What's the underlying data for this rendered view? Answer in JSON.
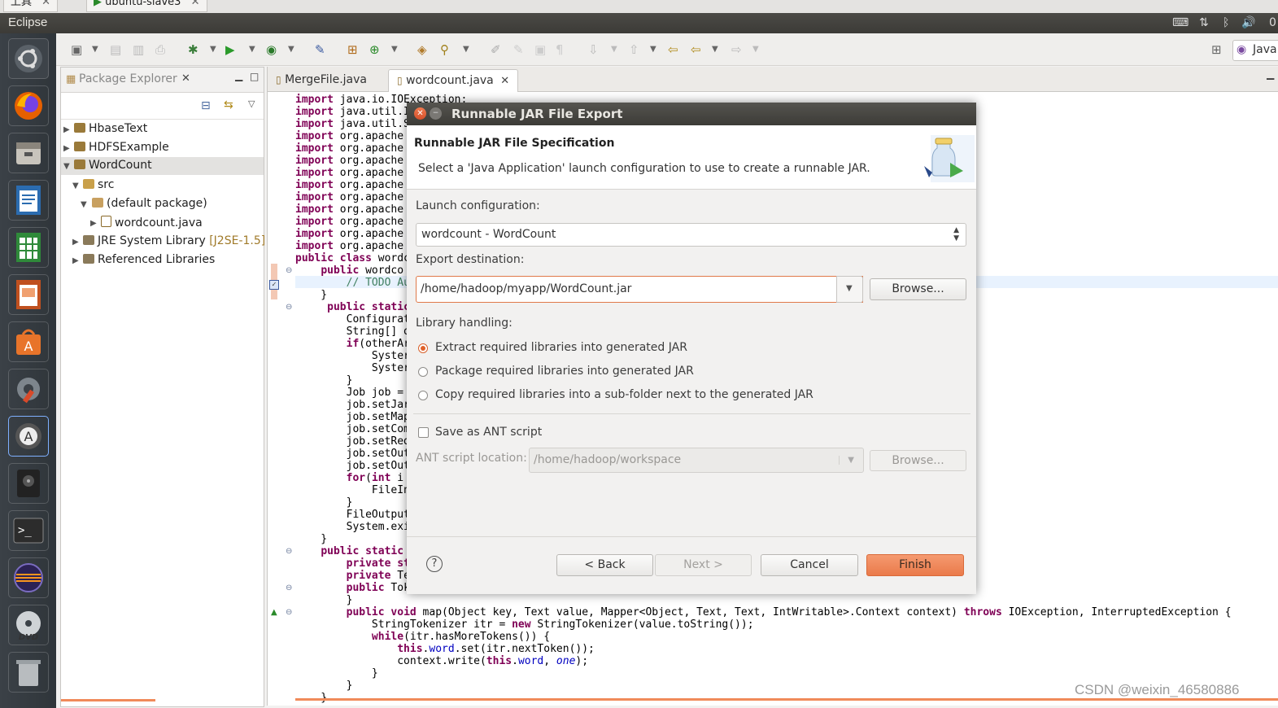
{
  "host_tabs": {
    "tab1": "上具",
    "tab2": "ubuntu-slave3"
  },
  "panel": {
    "app_title": "Eclipse",
    "clock_partial": "0"
  },
  "toolbar": {
    "perspective_label": "Java"
  },
  "package_explorer": {
    "title": "Package Explorer",
    "items": [
      {
        "label": "HbaseText"
      },
      {
        "label": "HDFSExample"
      },
      {
        "label": "WordCount"
      },
      {
        "label": "src"
      },
      {
        "label": "(default package)"
      },
      {
        "label": "wordcount.java"
      },
      {
        "label": "JRE System Library",
        "suffix": "[J2SE-1.5]"
      },
      {
        "label": "Referenced Libraries"
      }
    ]
  },
  "editor": {
    "tabs": [
      {
        "label": "MergeFile.java"
      },
      {
        "label": "wordcount.java"
      }
    ]
  },
  "dialog": {
    "title": "Runnable JAR File Export",
    "heading": "Runnable JAR File Specification",
    "description": "Select a 'Java Application' launch configuration to use to create a runnable JAR.",
    "launch_label": "Launch configuration:",
    "launch_value": "wordcount - WordCount",
    "export_label": "Export destination:",
    "export_value": "/home/hadoop/myapp/WordCount.jar",
    "browse": "Browse...",
    "library_label": "Library handling:",
    "options": [
      {
        "label": "Extract required libraries into generated JAR",
        "selected": true
      },
      {
        "label": "Package required libraries into generated JAR",
        "selected": false
      },
      {
        "label": "Copy required libraries into a sub-folder next to the generated JAR",
        "selected": false
      }
    ],
    "save_ant_label": "Save as ANT script",
    "save_ant_checked": false,
    "ant_location_label": "ANT script location:",
    "ant_location_value": "/home/hadoop/workspace",
    "ant_browse": "Browse...",
    "help": "?",
    "back": "< Back",
    "next": "Next >",
    "cancel": "Cancel",
    "finish": "Finish"
  },
  "watermark": "CSDN @weixin_46580886"
}
